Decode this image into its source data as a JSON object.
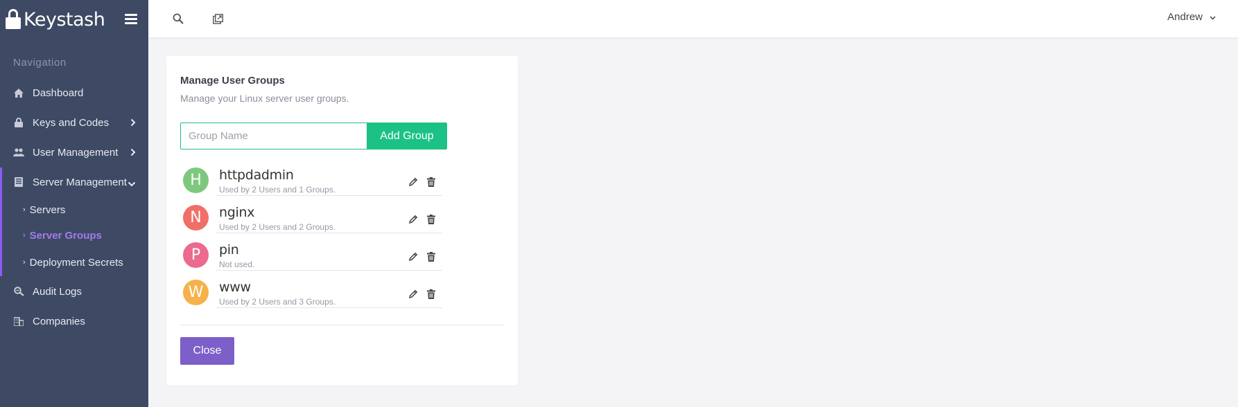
{
  "brand": {
    "name": "Keystash"
  },
  "sidebar": {
    "heading": "Navigation",
    "items": [
      {
        "label": "Dashboard",
        "icon": "home-icon"
      },
      {
        "label": "Keys and Codes",
        "icon": "lock-icon"
      },
      {
        "label": "User Management",
        "icon": "users-icon"
      },
      {
        "label": "Server Management",
        "icon": "server-icon"
      },
      {
        "label": "Audit Logs",
        "icon": "search-zoom-icon"
      },
      {
        "label": "Companies",
        "icon": "building-icon"
      }
    ],
    "sub_items": [
      {
        "label": "Servers",
        "active": false
      },
      {
        "label": "Server Groups",
        "active": true
      },
      {
        "label": "Deployment Secrets",
        "active": false
      }
    ]
  },
  "topbar": {
    "user": "Andrew"
  },
  "card": {
    "title": "Manage User Groups",
    "subtitle": "Manage your Linux server user groups.",
    "input_placeholder": "Group Name",
    "input_value": "",
    "add_label": "Add Group",
    "close_label": "Close",
    "groups": [
      {
        "initial": "H",
        "name": "httpdadmin",
        "usage": "Used by 2 Users and 1 Groups.",
        "color": "#7dc87d"
      },
      {
        "initial": "N",
        "name": "nginx",
        "usage": "Used by 2 Users and 2 Groups.",
        "color": "#f07067"
      },
      {
        "initial": "P",
        "name": "pin",
        "usage": "Not used.",
        "color": "#ec6a8e"
      },
      {
        "initial": "W",
        "name": "www",
        "usage": "Used by 2 Users and 3 Groups.",
        "color": "#f6b14a"
      }
    ]
  },
  "colors": {
    "sidebar_bg": "#3e4a63",
    "accent_green": "#1cc285",
    "accent_purple": "#7c5fc9",
    "active_nav": "#a47af0"
  }
}
